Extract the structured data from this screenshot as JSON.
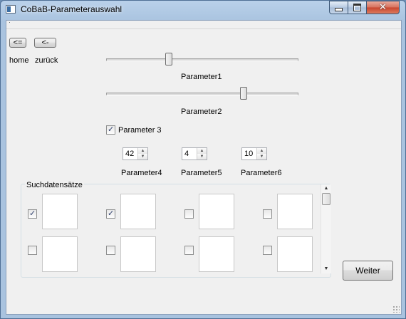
{
  "window": {
    "title": "CoBaB-Parameterauswahl"
  },
  "menubar": {
    "indicator": "·"
  },
  "nav": {
    "home_button_label": "<=",
    "back_button_label": "<-",
    "home_label": "home",
    "back_label": "zurück"
  },
  "sliders": [
    {
      "label": "Parameter1",
      "value_fraction": 0.32
    },
    {
      "label": "Parameter2",
      "value_fraction": 0.73
    }
  ],
  "checkbox_param3": {
    "label": "Parameter 3",
    "checked": true
  },
  "spinboxes": [
    {
      "label": "Parameter4",
      "value": "42"
    },
    {
      "label": "Parameter5",
      "value": "4"
    },
    {
      "label": "Parameter6",
      "value": "10"
    }
  ],
  "suchdatensaetze": {
    "title": "Suchdatensätze",
    "items": [
      {
        "checked": true
      },
      {
        "checked": true
      },
      {
        "checked": false
      },
      {
        "checked": false
      },
      {
        "checked": false
      },
      {
        "checked": false
      },
      {
        "checked": false
      },
      {
        "checked": false
      }
    ]
  },
  "footer": {
    "weiter_label": "Weiter"
  },
  "icons": {
    "app": "window-icon",
    "minimize": "minimize-icon",
    "maximize": "maximize-icon",
    "close": "close-icon",
    "spin_up": "chevron-up-icon",
    "spin_down": "chevron-down-icon",
    "scroll_up": "arrow-up-icon",
    "scroll_down": "arrow-down-icon",
    "resize": "resize-grip-icon"
  }
}
